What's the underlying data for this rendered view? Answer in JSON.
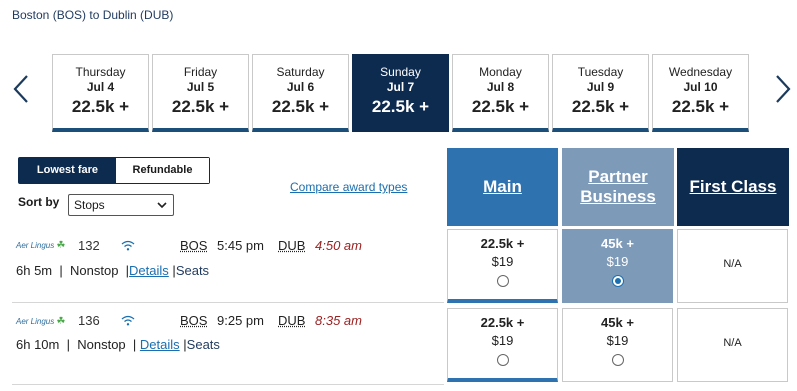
{
  "route": "Boston (BOS) to Dublin (DUB)",
  "dates": [
    {
      "dow": "Thursday",
      "date": "Jul 4",
      "fare": "22.5k +"
    },
    {
      "dow": "Friday",
      "date": "Jul 5",
      "fare": "22.5k +"
    },
    {
      "dow": "Saturday",
      "date": "Jul 6",
      "fare": "22.5k +"
    },
    {
      "dow": "Sunday",
      "date": "Jul 7",
      "fare": "22.5k +"
    },
    {
      "dow": "Monday",
      "date": "Jul 8",
      "fare": "22.5k +"
    },
    {
      "dow": "Tuesday",
      "date": "Jul 9",
      "fare": "22.5k +"
    },
    {
      "dow": "Wednesday",
      "date": "Jul 10",
      "fare": "22.5k +"
    }
  ],
  "toggle": {
    "lowest": "Lowest fare",
    "refundable": "Refundable"
  },
  "sort": {
    "label": "Sort by",
    "value": "Stops"
  },
  "compare": "Compare award types",
  "columns": {
    "main": "Main",
    "partner_line1": "Partner",
    "partner_line2": "Business",
    "first": "First Class"
  },
  "flights": [
    {
      "airline": "Aer Lingus",
      "flight": "132",
      "origin": "BOS",
      "dep": "5:45 pm",
      "dest": "DUB",
      "arr": "4:50 am",
      "duration": "6h 5m",
      "stops": "Nonstop",
      "details": "Details",
      "seats": "Seats",
      "main": {
        "pts": "22.5k +",
        "tax": "$19"
      },
      "partner": {
        "pts": "45k +",
        "tax": "$19"
      },
      "first": "N/A"
    },
    {
      "airline": "Aer Lingus",
      "flight": "136",
      "origin": "BOS",
      "dep": "9:25 pm",
      "dest": "DUB",
      "arr": "8:35 am",
      "duration": "6h 10m",
      "stops": "Nonstop",
      "details": "Details",
      "seats": "Seats",
      "main": {
        "pts": "22.5k +",
        "tax": "$19"
      },
      "partner": {
        "pts": "45k +",
        "tax": "$19"
      },
      "first": "N/A"
    }
  ],
  "separator": "|",
  "colors": {
    "navy": "#0d2a4f",
    "main": "#2e73b0",
    "partner": "#7d9ab8",
    "link": "#1a6fb0",
    "arrival": "#9b2121"
  }
}
